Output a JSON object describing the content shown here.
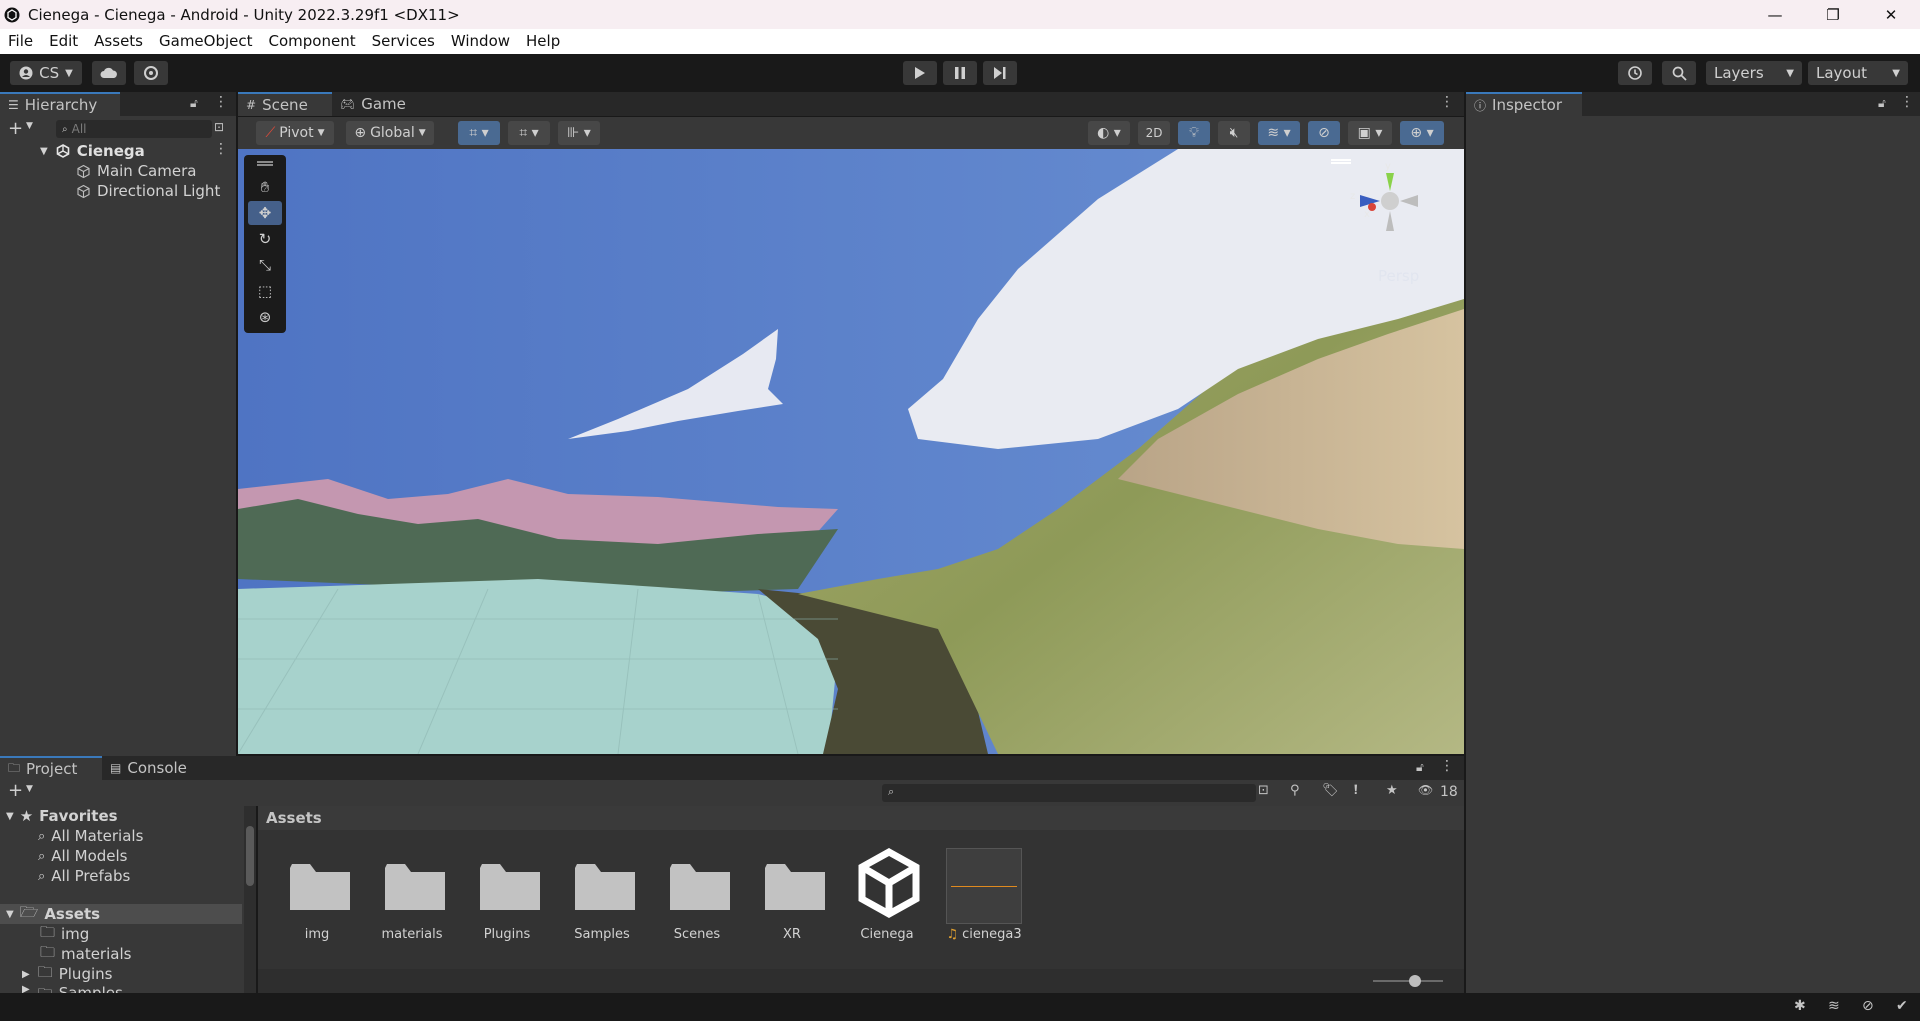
{
  "window": {
    "title": "Cienega - Cienega - Android - Unity 2022.3.29f1 <DX11>",
    "minimize_glyph": "—",
    "maximize_glyph": "❐",
    "close_glyph": "✕"
  },
  "menu": [
    "File",
    "Edit",
    "Assets",
    "GameObject",
    "Component",
    "Services",
    "Window",
    "Help"
  ],
  "toolbar": {
    "account_label": "CS",
    "layers_label": "Layers",
    "layout_label": "Layout"
  },
  "hierarchy": {
    "tab_label": "Hierarchy",
    "search_placeholder": "All",
    "scene_name": "Cienega",
    "items": [
      "Main Camera",
      "Directional Light"
    ]
  },
  "scene_view": {
    "tabs": [
      "Scene",
      "Game"
    ],
    "pivot_label": "Pivot",
    "global_label": "Global",
    "mode_2d_label": "2D",
    "persp_label": "Persp",
    "gizmo_axis_y": "y",
    "gizmo_axis_z": "z",
    "gizmo_axis_x": "x"
  },
  "inspector": {
    "tab_label": "Inspector"
  },
  "project": {
    "tabs": [
      "Project",
      "Console"
    ],
    "hidden_count": "18",
    "favorites": {
      "label": "Favorites",
      "items": [
        "All Materials",
        "All Models",
        "All Prefabs"
      ]
    },
    "tree": {
      "root": "Assets",
      "children": [
        "img",
        "materials",
        "Plugins",
        "Samples"
      ]
    },
    "breadcrumb": "Assets",
    "assets": [
      {
        "name": "img",
        "type": "folder"
      },
      {
        "name": "materials",
        "type": "folder"
      },
      {
        "name": "Plugins",
        "type": "folder"
      },
      {
        "name": "Samples",
        "type": "folder"
      },
      {
        "name": "Scenes",
        "type": "folder"
      },
      {
        "name": "XR",
        "type": "folder"
      },
      {
        "name": "Cienega",
        "type": "scene"
      },
      {
        "name": "cienega3",
        "type": "audio"
      }
    ]
  },
  "colors": {
    "accent": "#3a79bb",
    "panel_bg": "#383838",
    "toolbar_bg": "#191919",
    "header_bg": "#282828"
  }
}
